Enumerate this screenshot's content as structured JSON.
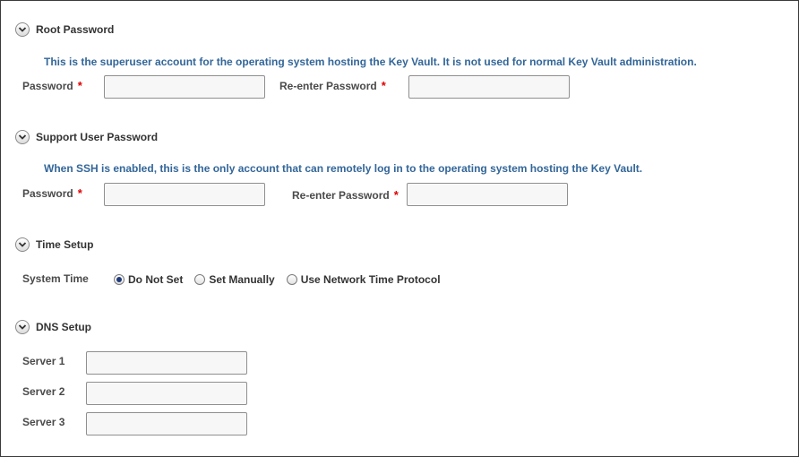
{
  "sections": {
    "root": {
      "title": "Root Password",
      "description": "This is the superuser account for the operating system hosting the Key Vault. It is not used for normal Key Vault administration.",
      "password_label": "Password",
      "reenter_label": "Re-enter Password",
      "required_mark": "*"
    },
    "support": {
      "title": "Support User Password",
      "description": "When SSH is enabled, this is the only account that can remotely log in to the operating system hosting the Key Vault.",
      "password_label": "Password",
      "reenter_label": "Re-enter Password",
      "required_mark": "*"
    },
    "time": {
      "title": "Time Setup",
      "system_time_label": "System Time",
      "options": [
        "Do Not Set",
        "Set Manually",
        "Use Network Time Protocol"
      ],
      "selected": "Do Not Set"
    },
    "dns": {
      "title": "DNS Setup",
      "server1_label": "Server 1",
      "server2_label": "Server 2",
      "server3_label": "Server 3"
    }
  },
  "icons": {
    "section_toggle": "chevron-down-icon"
  },
  "colors": {
    "description": "#336699",
    "required": "#e00000",
    "border": "#3a3a3a"
  }
}
